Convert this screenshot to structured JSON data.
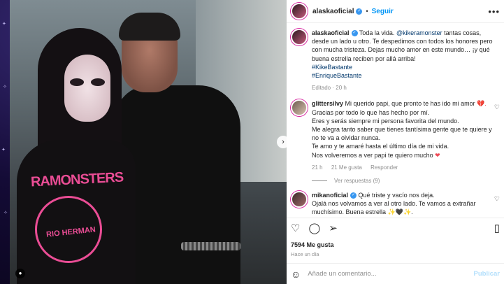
{
  "post": {
    "author": "alaskaoficial",
    "follow_label": "Seguir",
    "separator": "•",
    "more": "•••"
  },
  "image": {
    "shirt_text": "RAMONSTERS",
    "seal_text": "RIO HERMAN",
    "next_icon": "›",
    "tag_icon": "●"
  },
  "caption": {
    "author": "alaskaoficial",
    "text_before_mention": "Toda la vida. ",
    "mention": "@kikeramonster",
    "text_after_mention": " tantas cosas, desde un lado u otro. Te despedimos con todos los honores pero con mucha tristeza. Dejas mucho amor en este mundo… ¡y qué buena estrella reciben por allá arriba!",
    "hashtags": [
      "#KikeBastante",
      "#EnriqueBastante"
    ],
    "meta": "Editado · 20 h"
  },
  "comments": [
    {
      "author": "glittersilvy",
      "lines": [
        "Mi querido papi, que pronto te has ido mi amor",
        "Gracias por todo lo que has hecho por mí.",
        "Eres y serás siempre mi persona favorita del mundo.",
        "Me alegra tanto saber que tienes tantísima gente que te quiere y no te va a olvidar nunca.",
        "Te amo y te amaré hasta el último día de mi vida.",
        "Nos volveremos a ver papi te quiero mucho"
      ],
      "emoji_1": "💔.",
      "emoji_2": "❤",
      "time": "21 h",
      "likes": "21 Me gusta",
      "reply": "Responder",
      "view_replies": "Ver respuestas (9)"
    },
    {
      "author": "mikanoficial",
      "lines": [
        "Qué triste y vacío nos deja.",
        "Ojalá nos volvamos a ver al otro lado. Te vamos a extrañar muchísimo. Buena estrella ✨🖤✨."
      ]
    }
  ],
  "actions": {
    "heart_icon": "♡",
    "comment_icon": "◯",
    "share_icon": "➢",
    "save_icon": "▯"
  },
  "likes_count": "7594 Me gusta",
  "posted_ago": "Hace un día",
  "comment_box": {
    "emoji_icon": "☺",
    "placeholder": "Añade un comentario...",
    "publish_label": "Publicar"
  }
}
